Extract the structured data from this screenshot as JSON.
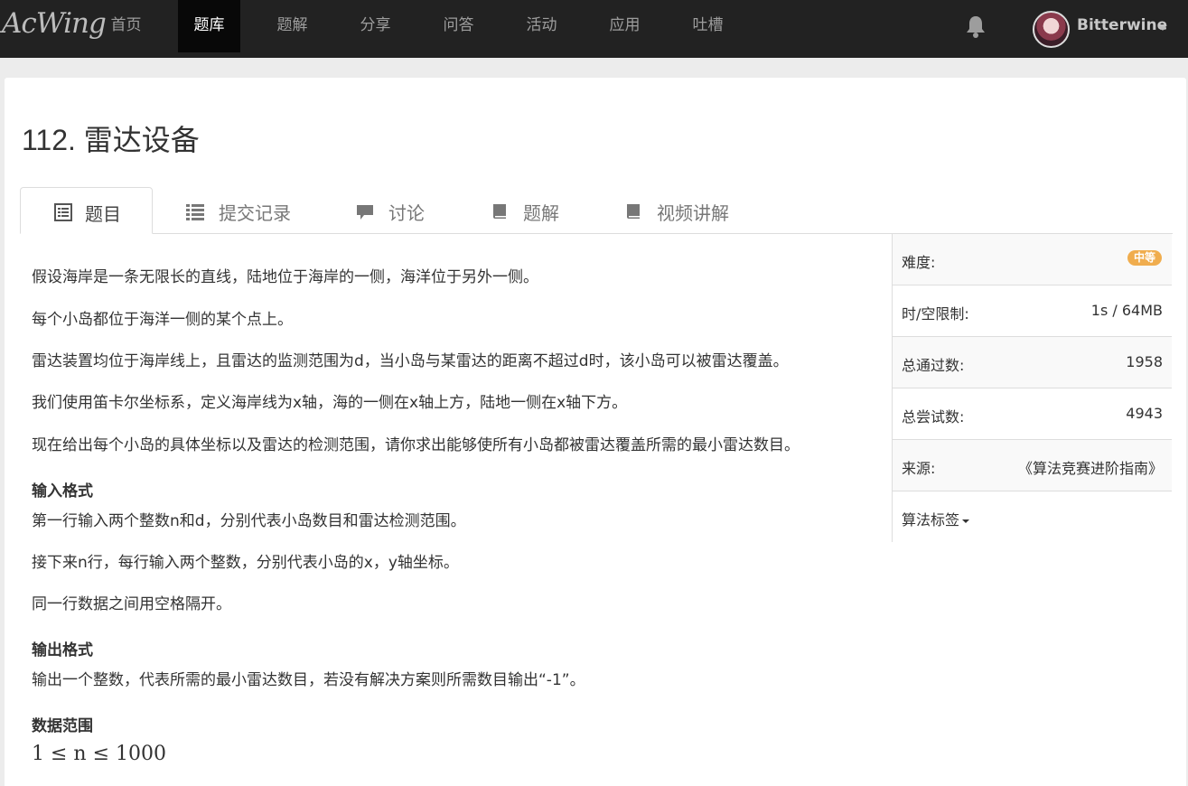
{
  "navbar": {
    "logo": "AcWing",
    "items": [
      {
        "label": "首页"
      },
      {
        "label": "题库"
      },
      {
        "label": "题解"
      },
      {
        "label": "分享"
      },
      {
        "label": "问答"
      },
      {
        "label": "活动"
      },
      {
        "label": "应用"
      },
      {
        "label": "吐槽"
      }
    ],
    "active_index": 1,
    "bell_icon": "bell-icon",
    "username": "Bitterwine"
  },
  "problem": {
    "title": "112. 雷达设备",
    "tabs": [
      {
        "label": "题目",
        "icon": "list-alt-icon"
      },
      {
        "label": "提交记录",
        "icon": "list-icon"
      },
      {
        "label": "讨论",
        "icon": "comment-icon"
      },
      {
        "label": "题解",
        "icon": "book-icon"
      },
      {
        "label": "视频讲解",
        "icon": "book-icon"
      }
    ],
    "paragraphs": [
      "假设海岸是一条无限长的直线，陆地位于海岸的一侧，海洋位于另外一侧。",
      "每个小岛都位于海洋一侧的某个点上。",
      "雷达装置均位于海岸线上，且雷达的监测范围为d，当小岛与某雷达的距离不超过d时，该小岛可以被雷达覆盖。",
      "我们使用笛卡尔坐标系，定义海岸线为x轴，海的一侧在x轴上方，陆地一侧在x轴下方。",
      "现在给出每个小岛的具体坐标以及雷达的检测范围，请你求出能够使所有小岛都被雷达覆盖所需的最小雷达数目。"
    ],
    "input_heading": "输入格式",
    "input_lines": [
      "第一行输入两个整数n和d，分别代表小岛数目和雷达检测范围。",
      "接下来n行，每行输入两个整数，分别代表小岛的x，y轴坐标。",
      "同一行数据之间用空格隔开。"
    ],
    "output_heading": "输出格式",
    "output_lines": [
      "输出一个整数，代表所需的最小雷达数目，若没有解决方案则所需数目输出“-1”。"
    ],
    "range_heading": "数据范围",
    "range_math": "1 ≤ n ≤ 1000"
  },
  "sidebar": {
    "difficulty_label": "难度:",
    "difficulty_value": "中等",
    "difficulty_color": "#f0ad4e",
    "limit_label": "时/空限制:",
    "limit_value": "1s / 64MB",
    "passed_label": "总通过数:",
    "passed_value": "1958",
    "tried_label": "总尝试数:",
    "tried_value": "4943",
    "source_label": "来源:",
    "source_value": "《算法竞赛进阶指南》",
    "tags_label": "算法标签"
  }
}
